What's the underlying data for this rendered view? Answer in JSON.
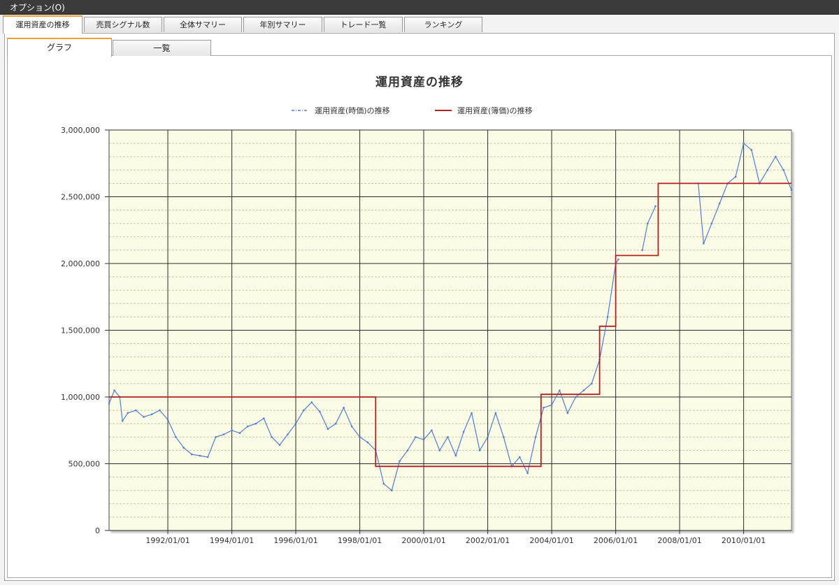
{
  "menu": {
    "options_label": "オプション(O)"
  },
  "main_tabs": [
    {
      "label": "運用資産の推移",
      "active": true
    },
    {
      "label": "売買シグナル数",
      "active": false
    },
    {
      "label": "全体サマリー",
      "active": false
    },
    {
      "label": "年別サマリー",
      "active": false
    },
    {
      "label": "トレード一覧",
      "active": false
    },
    {
      "label": "ランキング",
      "active": false
    }
  ],
  "sub_tabs": [
    {
      "label": "グラフ",
      "active": true
    },
    {
      "label": "一覧",
      "active": false
    }
  ],
  "colors": {
    "market_value_series": "#4f7fd3",
    "book_value_series": "#b22222",
    "plot_background": "#fbfbe6",
    "active_tab_accent": "#f0a030"
  },
  "chart_data": {
    "type": "line",
    "title": "運用資産の推移",
    "legend_position": "top-center",
    "grid": true,
    "xlim": [
      "1990/03/01",
      "2011/07/01"
    ],
    "ylim": [
      0,
      3000000
    ],
    "x_ticks": [
      "1992/01/01",
      "1994/01/01",
      "1996/01/01",
      "1998/01/01",
      "2000/01/01",
      "2002/01/01",
      "2004/01/01",
      "2006/01/01",
      "2008/01/01",
      "2010/01/01"
    ],
    "y_ticks": [
      0,
      500000,
      1000000,
      1500000,
      2000000,
      2500000,
      3000000
    ],
    "y_tick_labels": [
      "0",
      "500,000",
      "1,000,000",
      "1,500,000",
      "2,000,000",
      "2,500,000",
      "3,000,000"
    ],
    "series": [
      {
        "name": "運用資産(時価)の推移",
        "style": "dash-dot",
        "points": [
          [
            "1990/03/01",
            950000
          ],
          [
            "1990/05/01",
            1050000
          ],
          [
            "1990/07/01",
            1000000
          ],
          [
            "1990/08/01",
            820000
          ],
          [
            "1990/10/01",
            880000
          ],
          [
            "1991/01/01",
            900000
          ],
          [
            "1991/04/01",
            850000
          ],
          [
            "1991/07/01",
            870000
          ],
          [
            "1991/10/01",
            900000
          ],
          [
            "1992/01/01",
            830000
          ],
          [
            "1992/04/01",
            700000
          ],
          [
            "1992/07/01",
            620000
          ],
          [
            "1992/10/01",
            570000
          ],
          [
            "1993/01/01",
            560000
          ],
          [
            "1993/04/01",
            550000
          ],
          [
            "1993/07/01",
            700000
          ],
          [
            "1993/10/01",
            720000
          ],
          [
            "1994/01/01",
            750000
          ],
          [
            "1994/04/01",
            730000
          ],
          [
            "1994/07/01",
            780000
          ],
          [
            "1994/10/01",
            800000
          ],
          [
            "1995/01/01",
            840000
          ],
          [
            "1995/04/01",
            700000
          ],
          [
            "1995/07/01",
            640000
          ],
          [
            "1995/10/01",
            720000
          ],
          [
            "1996/01/01",
            800000
          ],
          [
            "1996/04/01",
            900000
          ],
          [
            "1996/07/01",
            960000
          ],
          [
            "1996/10/01",
            890000
          ],
          [
            "1997/01/01",
            760000
          ],
          [
            "1997/04/01",
            800000
          ],
          [
            "1997/07/01",
            920000
          ],
          [
            "1997/10/01",
            780000
          ],
          [
            "1998/01/01",
            700000
          ],
          [
            "1998/04/01",
            660000
          ],
          [
            "1998/07/01",
            600000
          ],
          [
            "1998/10/01",
            350000
          ],
          [
            "1999/01/01",
            300000
          ],
          [
            "1999/04/01",
            520000
          ],
          [
            "1999/07/01",
            600000
          ],
          [
            "1999/10/01",
            700000
          ],
          [
            "2000/01/01",
            680000
          ],
          [
            "2000/04/01",
            750000
          ],
          [
            "2000/07/01",
            600000
          ],
          [
            "2000/10/01",
            700000
          ],
          [
            "2001/01/01",
            560000
          ],
          [
            "2001/04/01",
            740000
          ],
          [
            "2001/07/01",
            880000
          ],
          [
            "2001/10/01",
            600000
          ],
          [
            "2002/01/01",
            700000
          ],
          [
            "2002/04/01",
            880000
          ],
          [
            "2002/07/01",
            700000
          ],
          [
            "2002/10/01",
            480000
          ],
          [
            "2003/01/01",
            550000
          ],
          [
            "2003/04/01",
            430000
          ],
          [
            "2003/07/01",
            700000
          ],
          [
            "2003/10/01",
            920000
          ],
          [
            "2004/01/01",
            940000
          ],
          [
            "2004/04/01",
            1050000
          ],
          [
            "2004/07/01",
            880000
          ],
          [
            "2004/10/01",
            1000000
          ],
          [
            "2005/01/01",
            1050000
          ],
          [
            "2005/04/01",
            1100000
          ],
          [
            "2005/07/01",
            1280000
          ],
          [
            "2005/10/01",
            1600000
          ],
          [
            "2006/01/01",
            2000000
          ],
          [
            "2006/02/01",
            2030000
          ],
          [
            "gap",
            null
          ],
          [
            "2006/11/01",
            2100000
          ],
          [
            "2007/01/01",
            2300000
          ],
          [
            "2007/04/01",
            2430000
          ],
          [
            "gap",
            null
          ],
          [
            "2008/08/01",
            2600000
          ],
          [
            "2008/10/01",
            2150000
          ],
          [
            "2009/01/01",
            2300000
          ],
          [
            "2009/04/01",
            2450000
          ],
          [
            "2009/07/01",
            2600000
          ],
          [
            "2009/10/01",
            2650000
          ],
          [
            "2010/01/01",
            2900000
          ],
          [
            "2010/04/01",
            2850000
          ],
          [
            "2010/07/01",
            2600000
          ],
          [
            "2010/10/01",
            2700000
          ],
          [
            "2011/01/01",
            2800000
          ],
          [
            "2011/04/01",
            2700000
          ],
          [
            "2011/07/01",
            2550000
          ]
        ]
      },
      {
        "name": "運用資産(簿価)の推移",
        "style": "solid",
        "points": [
          [
            "1990/03/01",
            1000000
          ],
          [
            "1998/07/01",
            1000000
          ],
          [
            "1998/07/01",
            480000
          ],
          [
            "2003/09/01",
            480000
          ],
          [
            "2003/09/01",
            1020000
          ],
          [
            "2005/07/01",
            1020000
          ],
          [
            "2005/07/01",
            1530000
          ],
          [
            "2006/01/01",
            1530000
          ],
          [
            "2006/01/01",
            2060000
          ],
          [
            "2007/05/01",
            2060000
          ],
          [
            "2007/05/01",
            2600000
          ],
          [
            "2011/07/01",
            2600000
          ]
        ]
      }
    ]
  }
}
